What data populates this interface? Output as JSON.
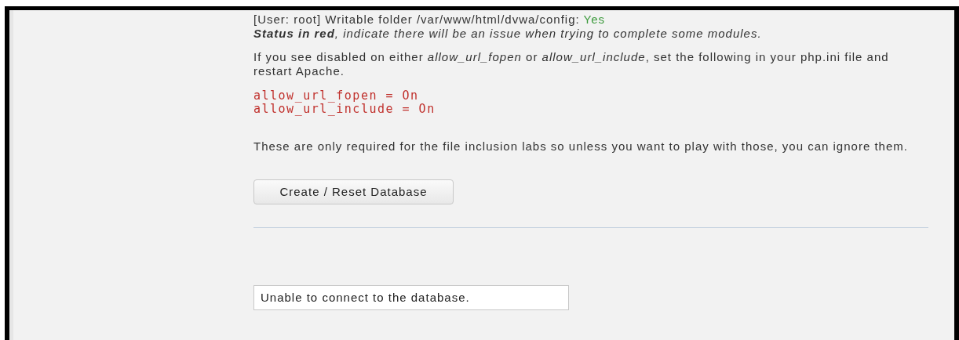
{
  "status_line": {
    "label": "[User: root] Writable folder /var/www/html/dvwa/config:",
    "value": "Yes",
    "ok": true
  },
  "status_note": "**Status in red**, indicate there will be an issue when trying to complete some modules.",
  "instructions": "If you see disabled on either *allow_url_fopen* or *allow_url_include*, set the following in your php.ini file and restart Apache.",
  "code_lines": [
    "allow_url_fopen = On",
    "allow_url_include = On"
  ],
  "note": "These are only required for the file inclusion labs so unless you want to play with those, you can ignore them.",
  "button": "Create / Reset Database",
  "message": "Unable to connect to the database."
}
